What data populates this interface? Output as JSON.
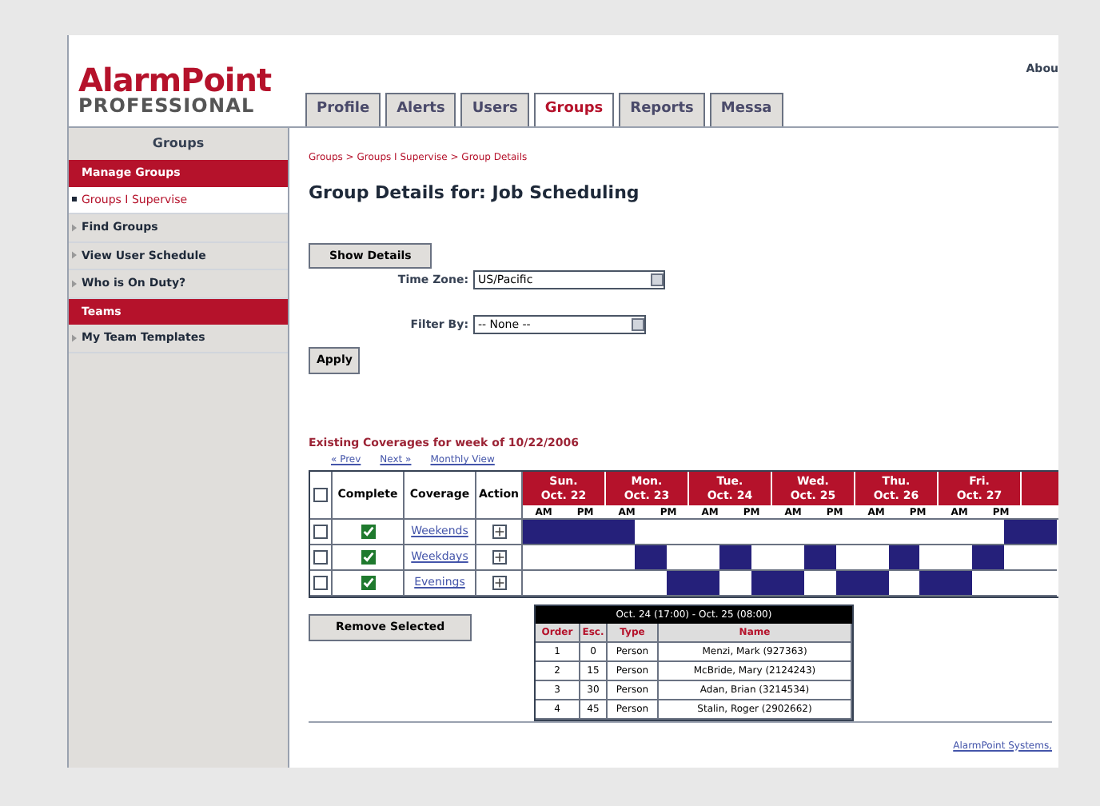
{
  "header": {
    "logo_main": "AlarmPoint",
    "logo_sub": "PROFESSIONAL",
    "top_link": "Abou"
  },
  "tabs": [
    {
      "label": "Profile",
      "selected": false
    },
    {
      "label": "Alerts",
      "selected": false
    },
    {
      "label": "Users",
      "selected": false
    },
    {
      "label": "Groups",
      "selected": true
    },
    {
      "label": "Reports",
      "selected": false
    },
    {
      "label": "Messa",
      "selected": false
    }
  ],
  "sidebar": {
    "title": "Groups",
    "sections": [
      {
        "title": "Manage Groups",
        "items": [
          {
            "label": "Groups I Supervise",
            "selected": true
          },
          {
            "label": "Find Groups",
            "selected": false
          },
          {
            "label": "View User Schedule",
            "selected": false
          },
          {
            "label": "Who is On Duty?",
            "selected": false
          }
        ]
      },
      {
        "title": "Teams",
        "items": [
          {
            "label": "My Team Templates",
            "selected": false
          }
        ]
      }
    ]
  },
  "breadcrumb": "Groups > Groups I Supervise > Group Details",
  "page_title": "Group Details for: Job Scheduling",
  "show_details_button": "Show Details",
  "time_zone": {
    "label": "Time Zone:",
    "value": "US/Pacific"
  },
  "filter_by": {
    "label": "Filter By:",
    "value": "-- None --"
  },
  "apply_button": "Apply",
  "coverages": {
    "title": "Existing Coverages for week of 10/22/2006",
    "nav_links": [
      "« Prev",
      "Next »",
      "Monthly View"
    ],
    "select_all_checked": false,
    "columns": [
      "Complete",
      "Coverage",
      "Action"
    ],
    "days": [
      {
        "day": "Sun.",
        "date": "Oct. 22",
        "halves": [
          "AM",
          "PM"
        ]
      },
      {
        "day": "Mon.",
        "date": "Oct. 23",
        "halves": [
          "AM",
          "PM"
        ]
      },
      {
        "day": "Tue.",
        "date": "Oct. 24",
        "halves": [
          "AM",
          "PM"
        ]
      },
      {
        "day": "Wed.",
        "date": "Oct. 25",
        "halves": [
          "AM",
          "PM"
        ]
      },
      {
        "day": "Thu.",
        "date": "Oct. 26",
        "halves": [
          "AM",
          "PM"
        ]
      },
      {
        "day": "Fri.",
        "date": "Oct. 27",
        "halves": [
          "AM",
          "PM"
        ]
      }
    ],
    "rows": [
      {
        "name": "Weekends",
        "checked": false,
        "complete": true,
        "slots": [
          true,
          true,
          true,
          true,
          false,
          false,
          false,
          false,
          false,
          false,
          false,
          false,
          false,
          false,
          false,
          false,
          false,
          true,
          true
        ]
      },
      {
        "name": "Weekdays",
        "checked": false,
        "complete": true,
        "slots": [
          false,
          false,
          false,
          false,
          true,
          false,
          false,
          true,
          false,
          false,
          true,
          false,
          false,
          true,
          false,
          false,
          true,
          false,
          false
        ]
      },
      {
        "name": "Evenings",
        "checked": false,
        "complete": true,
        "slots": [
          false,
          false,
          false,
          false,
          false,
          true,
          true,
          false,
          true,
          true,
          false,
          true,
          true,
          false,
          true,
          true,
          false,
          false,
          false
        ]
      }
    ],
    "remove_button": "Remove Selected"
  },
  "tooltip": {
    "title": "Oct. 24 (17:00) - Oct. 25 (08:00)",
    "columns": [
      "Order",
      "Esc.",
      "Type",
      "Name"
    ],
    "rows": [
      [
        "1",
        "0",
        "Person",
        "Menzi, Mark (927363)"
      ],
      [
        "2",
        "15",
        "Person",
        "McBride, Mary (2124243)"
      ],
      [
        "3",
        "30",
        "Person",
        "Adan, Brian (3214534)"
      ],
      [
        "4",
        "45",
        "Person",
        "Stalin, Roger (2902662)"
      ]
    ]
  },
  "footer_link": "AlarmPoint Systems,"
}
